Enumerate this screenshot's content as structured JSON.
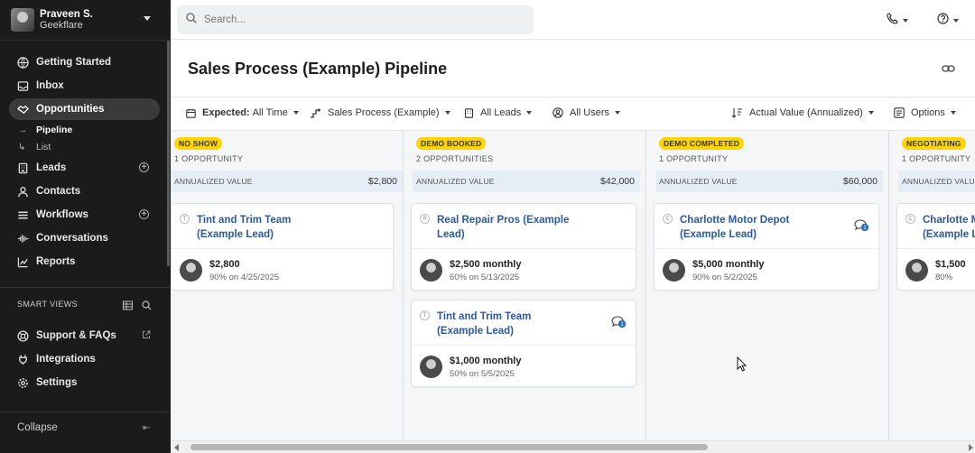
{
  "user": {
    "name": "Praveen S.",
    "org": "Geekflare"
  },
  "nav": {
    "getting_started": "Getting Started",
    "inbox": "Inbox",
    "opportunities": "Opportunities",
    "pipeline": "Pipeline",
    "list": "List",
    "leads": "Leads",
    "contacts": "Contacts",
    "workflows": "Workflows",
    "conversations": "Conversations",
    "reports": "Reports"
  },
  "smart_views": {
    "label": "SMART VIEWS"
  },
  "footer_nav": {
    "support": "Support & FAQs",
    "integrations": "Integrations",
    "settings": "Settings",
    "collapse": "Collapse"
  },
  "search": {
    "placeholder": "Search..."
  },
  "page": {
    "title": "Sales Process (Example) Pipeline"
  },
  "filters": {
    "expected_label": "Expected:",
    "expected_value": "All Time",
    "pipeline": "Sales Process (Example)",
    "leads": "All Leads",
    "users": "All Users",
    "sort": "Actual Value (Annualized)",
    "options": "Options"
  },
  "columns": [
    {
      "stage": "NO SHOW",
      "count": "1 OPPORTUNITY",
      "value_label": "ANNUALIZED VALUE",
      "value": "$2,800",
      "cards": [
        {
          "initial": "T",
          "name": "Tint and Trim Team\n(Example Lead)",
          "amount": "$2,800",
          "meta": "90% on 4/25/2025",
          "messages": ""
        }
      ]
    },
    {
      "stage": "DEMO BOOKED",
      "count": "2 OPPORTUNITIES",
      "value_label": "ANNUALIZED VALUE",
      "value": "$42,000",
      "cards": [
        {
          "initial": "R",
          "name": "Real Repair Pros (Example\nLead)",
          "amount": "$2,500 monthly",
          "meta": "60% on 5/13/2025",
          "messages": ""
        },
        {
          "initial": "T",
          "name": "Tint and Trim Team\n(Example Lead)",
          "amount": "$1,000 monthly",
          "meta": "50% on 5/5/2025",
          "messages": "1"
        }
      ]
    },
    {
      "stage": "DEMO COMPLETED",
      "count": "1 OPPORTUNITY",
      "value_label": "ANNUALIZED VALUE",
      "value": "$60,000",
      "cards": [
        {
          "initial": "C",
          "name": "Charlotte Motor Depot\n(Example Lead)",
          "amount": "$5,000 monthly",
          "meta": "90% on 5/2/2025",
          "messages": "1"
        }
      ]
    },
    {
      "stage": "NEGOTIATING",
      "count": "1 OPPORTUNITY",
      "value_label": "ANNUALIZED VALUE",
      "value": "",
      "cards": [
        {
          "initial": "C",
          "name": "Charlotte M\n(Example Le",
          "amount": "$1,500",
          "meta": "80%",
          "messages": ""
        }
      ]
    }
  ],
  "colors": {
    "accent": "#2c5aa0",
    "badge": "#ffd500",
    "sidebar": "#1b1b1b",
    "value_band": "#e5eef7"
  }
}
